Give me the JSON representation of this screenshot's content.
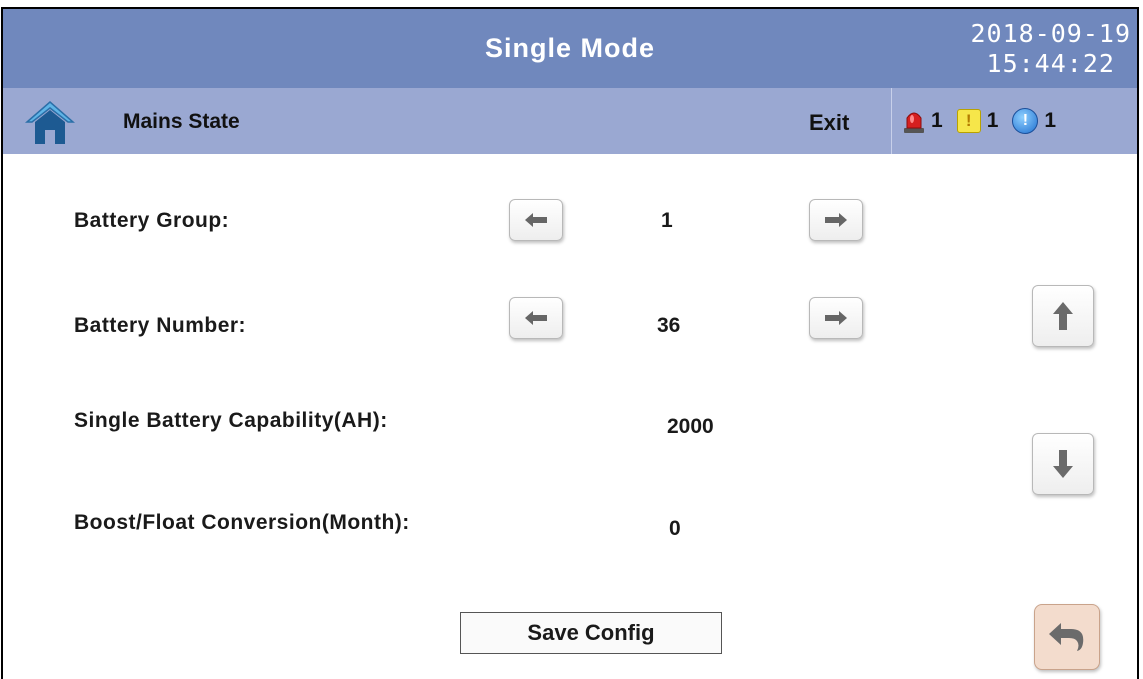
{
  "header": {
    "title": "Single Mode",
    "date": "2018-09-19",
    "time": "15:44:22"
  },
  "subbar": {
    "state_label": "Mains State",
    "exit_label": "Exit",
    "alarms": [
      {
        "icon": "alarm-siren-icon",
        "count": "1"
      },
      {
        "icon": "warning-icon",
        "count": "1"
      },
      {
        "icon": "info-icon",
        "count": "1"
      }
    ]
  },
  "settings": {
    "battery_group": {
      "label": "Battery Group:",
      "value": "1"
    },
    "battery_number": {
      "label": "Battery Number:",
      "value": "36"
    },
    "capability": {
      "label": "Single Battery Capability(AH):",
      "value": "2000"
    },
    "conversion": {
      "label": "Boost/Float Conversion(Month):",
      "value": "0"
    }
  },
  "actions": {
    "save_label": "Save Config"
  },
  "colors": {
    "title_bar": "#7088bd",
    "sub_bar": "#9aa8d2",
    "back_button": "#f3dccd"
  }
}
